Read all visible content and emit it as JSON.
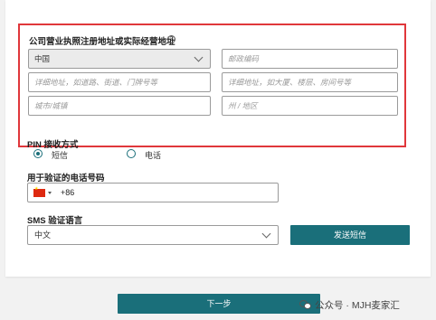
{
  "address": {
    "label": "公司营业执照注册地址或实际经营地址",
    "help_icon": "?",
    "country_value": "中国",
    "postal_placeholder": "邮政编码",
    "street_placeholder": "详细地址，如道路、街道、门牌号等",
    "unit_placeholder": "详细地址，如大厦、楼层、房间号等",
    "city_placeholder": "城市/城镇",
    "state_placeholder": "州 / 地区"
  },
  "pin": {
    "label": "PIN 接收方式",
    "option_sms": "短信",
    "option_phone": "电话",
    "selected": "短信"
  },
  "phone": {
    "label": "用于验证的电话号码",
    "country_flag": "cn-flag-icon",
    "code": "+86"
  },
  "sms_lang": {
    "label": "SMS 验证语言",
    "value": "中文"
  },
  "buttons": {
    "send_sms": "发送短信",
    "next": "下一步"
  },
  "watermark": {
    "text": "公众号 · MJH麦家汇"
  },
  "colors": {
    "accent": "#1a6f7a",
    "highlight_border": "#e0373b"
  }
}
